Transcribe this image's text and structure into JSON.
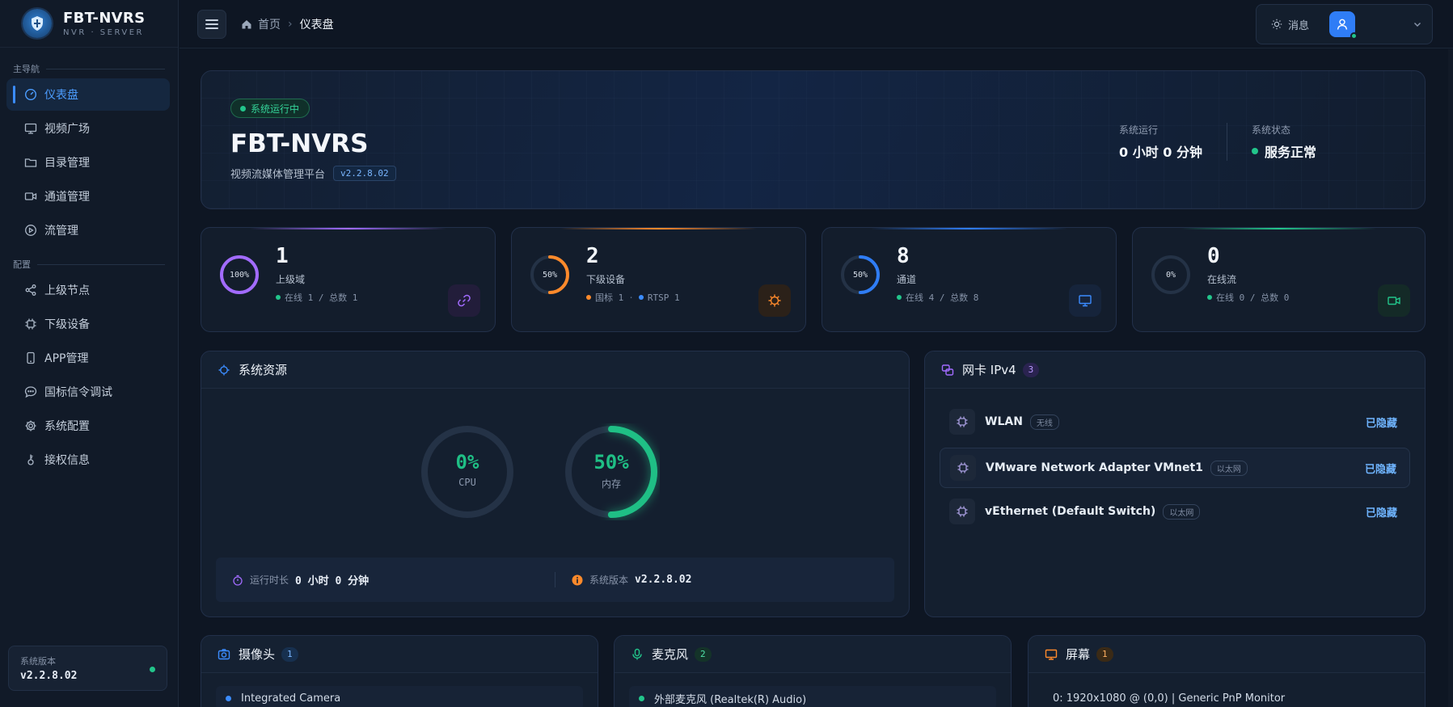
{
  "brand": {
    "title": "FBT-NVRS",
    "subtitle": "NVR · SERVER"
  },
  "sidebar": {
    "group_main": "主导航",
    "group_config": "配置",
    "main_items": [
      {
        "label": "仪表盘",
        "icon": "dashboard-icon",
        "active": true
      },
      {
        "label": "视频广场",
        "icon": "monitor-icon"
      },
      {
        "label": "目录管理",
        "icon": "folder-icon"
      },
      {
        "label": "通道管理",
        "icon": "camera-icon"
      },
      {
        "label": "流管理",
        "icon": "play-icon"
      }
    ],
    "config_items": [
      {
        "label": "上级节点",
        "icon": "share-icon"
      },
      {
        "label": "下级设备",
        "icon": "chip-icon"
      },
      {
        "label": "APP管理",
        "icon": "phone-icon"
      },
      {
        "label": "国标信令调试",
        "icon": "chat-icon"
      },
      {
        "label": "系统配置",
        "icon": "gear-icon"
      },
      {
        "label": "接权信息",
        "icon": "key-icon"
      }
    ],
    "version_label": "系统版本",
    "version_value": "v2.2.8.02"
  },
  "topbar": {
    "crumb_home": "首页",
    "crumb_sep": "›",
    "crumb_current": "仪表盘",
    "message_label": "消息"
  },
  "hero": {
    "status": "系统运行中",
    "title": "FBT-NVRS",
    "subtitle": "视频流媒体管理平台",
    "version": "v2.2.8.02",
    "uptime_label": "系统运行",
    "uptime_value": "0 小时 0 分钟",
    "state_label": "系统状态",
    "state_value": "服务正常"
  },
  "stats": [
    {
      "pct_text": "100%",
      "pct": 1.0,
      "value": "1",
      "name": "上级域",
      "color": "#a26bff",
      "sub": [
        {
          "text": "在线 1 / 总数 1",
          "dot": "#22c58b"
        }
      ]
    },
    {
      "pct_text": "50%",
      "pct": 0.5,
      "value": "2",
      "name": "下级设备",
      "color": "#ff8a2b",
      "sub": [
        {
          "text": "国标 1",
          "dot": "#ff8a2b"
        },
        {
          "text": "RTSP 1",
          "dot": "#3b8cff"
        }
      ]
    },
    {
      "pct_text": "50%",
      "pct": 0.5,
      "value": "8",
      "name": "通道",
      "color": "#2f7df6",
      "sub": [
        {
          "text": "在线 4 / 总数 8",
          "dot": "#22c58b"
        }
      ]
    },
    {
      "pct_text": "0%",
      "pct": 0.0,
      "value": "0",
      "name": "在线流",
      "color": "#22c58b",
      "sub": [
        {
          "text": "在线 0 / 总数 0",
          "dot": "#22c58b"
        }
      ]
    }
  ],
  "resources": {
    "title": "系统资源",
    "cpu_value": "0%",
    "cpu_label": "CPU",
    "cpu_pct": 0.0,
    "mem_value": "50%",
    "mem_label": "内存",
    "mem_pct": 0.5,
    "uptime_label": "运行时长",
    "uptime_value": "0 小时 0 分钟",
    "version_label": "系统版本",
    "version_value": "v2.2.8.02"
  },
  "nics": {
    "title": "网卡 IPv4",
    "count": "3",
    "items": [
      {
        "name": "WLAN",
        "type": "无线",
        "state": "已隐藏"
      },
      {
        "name": "VMware Network Adapter VMnet1",
        "type": "以太网",
        "state": "已隐藏"
      },
      {
        "name": "vEthernet (Default Switch)",
        "type": "以太网",
        "state": "已隐藏"
      }
    ]
  },
  "cameras": {
    "title": "摄像头",
    "count": "1",
    "items": [
      "Integrated Camera"
    ]
  },
  "mics": {
    "title": "麦克风",
    "count": "2",
    "items": [
      "外部麦克风 (Realtek(R) Audio)"
    ]
  },
  "screens": {
    "title": "屏幕",
    "count": "1",
    "items": [
      "0: 1920x1080 @ (0,0) | Generic PnP Monitor"
    ]
  },
  "colors": {
    "accent": "#3b8cff",
    "success": "#22c58b",
    "warning": "#ff8a2b",
    "purple": "#a26bff"
  }
}
